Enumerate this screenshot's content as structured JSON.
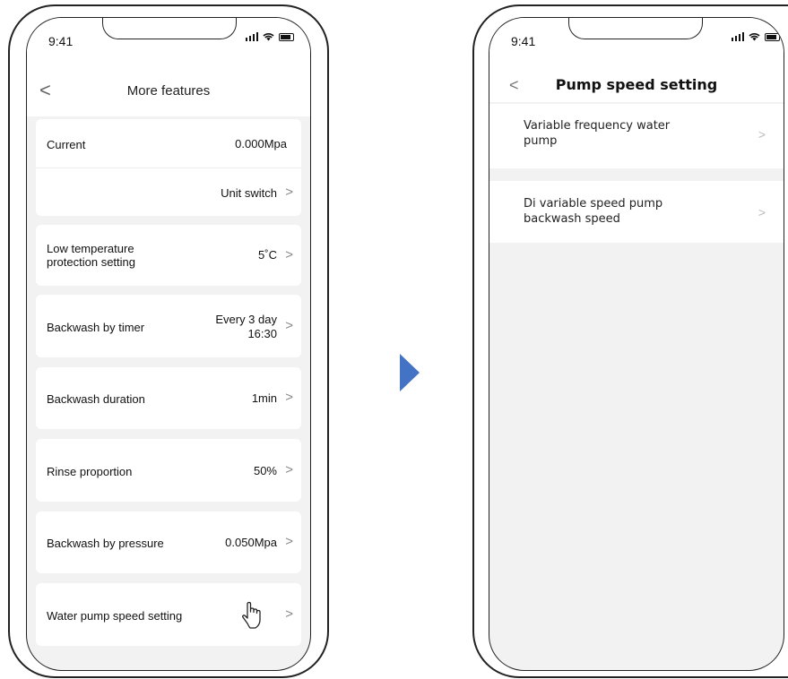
{
  "left_screen": {
    "time": "9:41",
    "title": "More features",
    "rows": [
      {
        "label": "Current",
        "value": "0.000Mpa"
      },
      {
        "label": "",
        "value": "Unit switch"
      },
      {
        "label": "Low temperature\nprotection setting",
        "value": "5˚C"
      },
      {
        "label": "Backwash by timer",
        "value_line1": "Every 3 day",
        "value_line2": "16:30"
      },
      {
        "label": "Backwash duration",
        "value": "1min"
      },
      {
        "label": "Rinse proportion",
        "value": "50%"
      },
      {
        "label": "Backwash by pressure",
        "value": "0.050Mpa"
      },
      {
        "label": "Water pump speed setting",
        "value": ""
      }
    ],
    "chevron": ">",
    "back": "<"
  },
  "right_screen": {
    "time": "9:41",
    "title": "Pump speed setting",
    "back": "<",
    "rows": [
      {
        "label_line1": "Variable frequency water",
        "label_line2": "pump"
      },
      {
        "label_line1": "Di variable speed pump",
        "label_line2": "backwash speed"
      }
    ],
    "chevron": ">"
  },
  "icons": {
    "transition_arrow": "play-arrow-icon",
    "pointer": "hand-pointer-icon",
    "accent_color": "#4472c4"
  }
}
